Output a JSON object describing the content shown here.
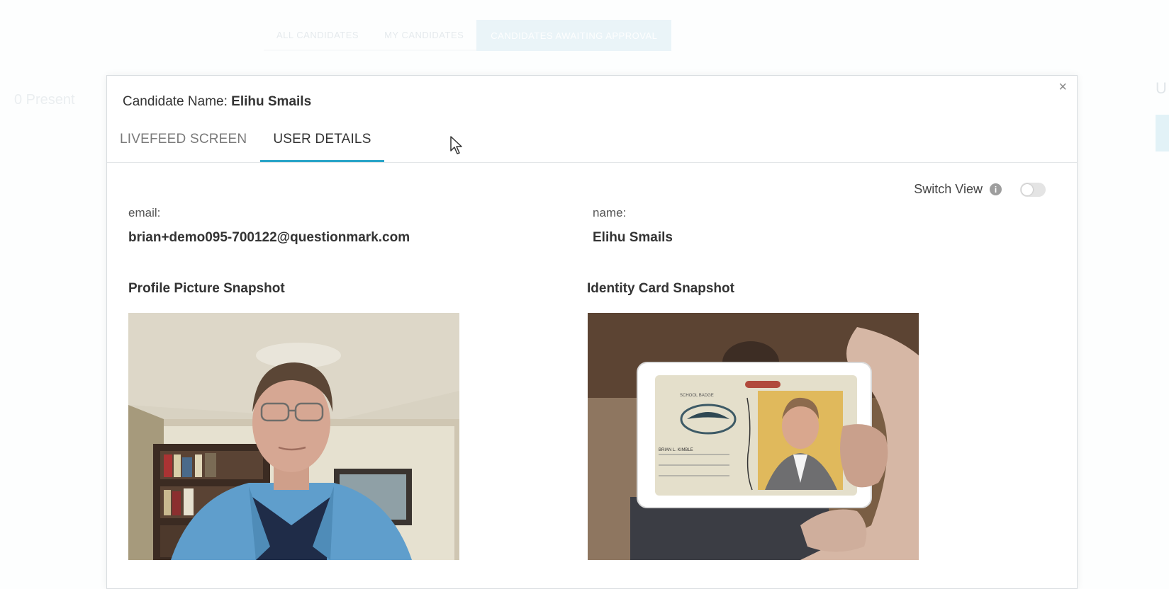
{
  "background": {
    "tabs": [
      {
        "label": "ALL CANDIDATES",
        "active": false
      },
      {
        "label": "MY CANDIDATES",
        "active": false
      },
      {
        "label": "CANDIDATES AWAITING APPROVAL",
        "active": true
      }
    ],
    "left_text": "0 Present",
    "right_text": "U"
  },
  "modal": {
    "candidate_label": "Candidate Name:",
    "candidate_name": "Elihu Smails",
    "close_glyph": "×",
    "tabs": [
      {
        "label": "LIVEFEED SCREEN",
        "active": false
      },
      {
        "label": "USER DETAILS",
        "active": true
      }
    ],
    "switch_view": {
      "label": "Switch View",
      "info_glyph": "i",
      "enabled": false
    },
    "email": {
      "label": "email:",
      "value": "brian+demo095-700122@questionmark.com"
    },
    "name": {
      "label": "name:",
      "value": "Elihu Smails"
    },
    "profile_snapshot": {
      "title": "Profile Picture Snapshot"
    },
    "identity_snapshot": {
      "title": "Identity Card Snapshot",
      "card_text_1": "SCHOOL BADGE",
      "card_text_2": "BRIAN L. KIMBLE"
    }
  },
  "icons": [
    "close-icon",
    "info-icon",
    "mouse-cursor-icon",
    "toggle-switch"
  ],
  "colors": {
    "accent": "#2aa5c8",
    "modal_border": "#d9dde0",
    "inactive_tab": "#7a7a7a"
  }
}
